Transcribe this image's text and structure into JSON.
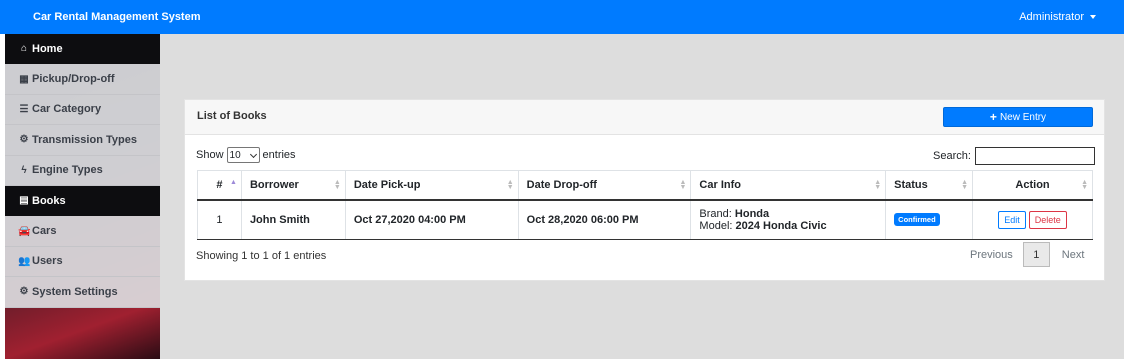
{
  "app": {
    "title": "Car Rental Management System",
    "user": "Administrator"
  },
  "sidebar": {
    "items": [
      {
        "label": "Home",
        "icon": "home-icon",
        "glyph": "⌂"
      },
      {
        "label": "Pickup/Drop-off",
        "icon": "table-icon",
        "glyph": "▦"
      },
      {
        "label": "Car Category",
        "icon": "list-icon",
        "glyph": "☰"
      },
      {
        "label": "Transmission Types",
        "icon": "gear-icon",
        "glyph": "⚙"
      },
      {
        "label": "Engine Types",
        "icon": "bolt-icon",
        "glyph": "ϟ"
      },
      {
        "label": "Books",
        "icon": "book-icon",
        "glyph": "▤"
      },
      {
        "label": "Cars",
        "icon": "car-icon",
        "glyph": "🚘"
      },
      {
        "label": "Users",
        "icon": "users-icon",
        "glyph": "👥"
      },
      {
        "label": "System Settings",
        "icon": "cogs-icon",
        "glyph": "⚙"
      }
    ]
  },
  "card": {
    "title": "List of Books",
    "new_entry": "New Entry",
    "show_label": "Show",
    "entries_label": "entries",
    "length_value": "10",
    "search_label": "Search:",
    "search_value": ""
  },
  "table": {
    "columns": [
      "#",
      "Borrower",
      "Date Pick-up",
      "Date Drop-off",
      "Car Info",
      "Status",
      "Action"
    ],
    "rows": [
      {
        "num": "1",
        "borrower": "John Smith",
        "pickup": "Oct 27,2020 04:00 PM",
        "dropoff": "Oct 28,2020 06:00 PM",
        "brand_label": "Brand:",
        "brand": "Honda",
        "model_label": "Model:",
        "model": "2024 Honda Civic",
        "status": "Confirmed",
        "edit": "Edit",
        "delete": "Delete"
      }
    ]
  },
  "footer": {
    "info": "Showing 1 to 1 of 1 entries",
    "previous": "Previous",
    "page": "1",
    "next": "Next"
  },
  "colors": {
    "primary": "#007bff",
    "danger": "#dc3545",
    "sidebar_active": "#0d0d10"
  }
}
